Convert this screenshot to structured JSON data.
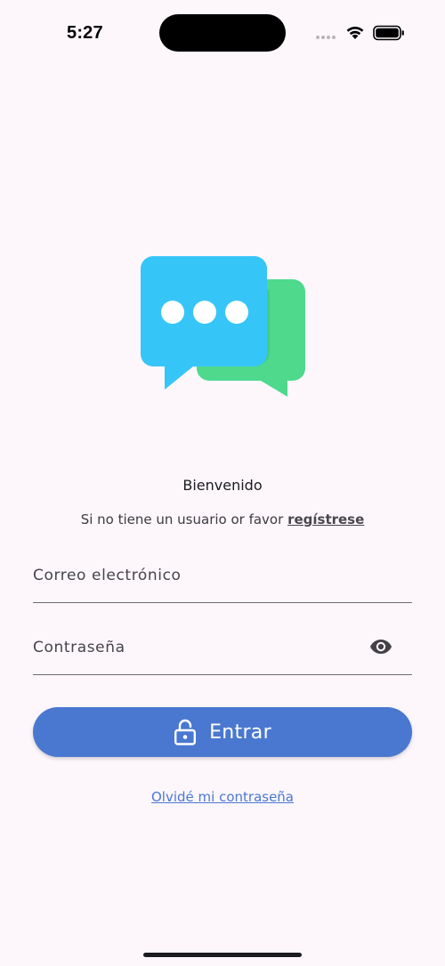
{
  "status_bar": {
    "time": "5:27"
  },
  "icons": {
    "logo": "chat-bubbles-logo",
    "wifi": "wifi-icon",
    "battery": "battery-icon",
    "visibility": "eye-icon",
    "lock": "unlocked-padlock-icon"
  },
  "colors": {
    "background": "#fdf7fc",
    "primary": "#4a78d0",
    "bubble_blue": "#36c5f7",
    "bubble_green": "#4ed98d"
  },
  "welcome": {
    "title": "Bienvenido",
    "register_prompt": "Si no tiene un usuario or favor",
    "register_link": "regístrese"
  },
  "form": {
    "email_label": "Correo electrónico",
    "password_label": "Contraseña",
    "submit_label": "Entrar"
  },
  "forgot_password": "Olvidé mi contraseña"
}
